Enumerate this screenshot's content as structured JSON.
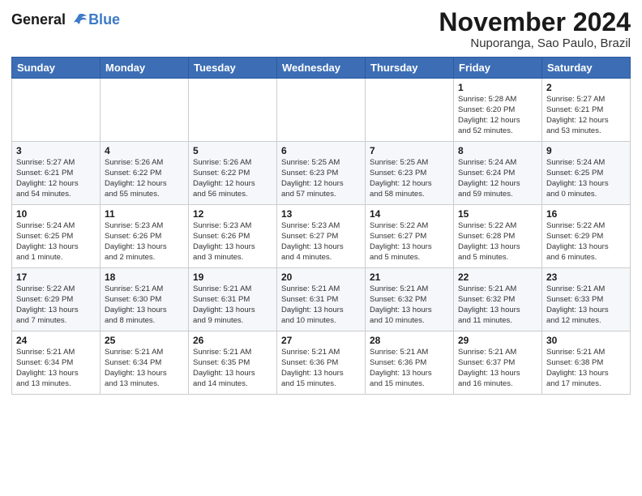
{
  "logo": {
    "line1": "General",
    "line2": "Blue"
  },
  "title": "November 2024",
  "location": "Nuporanga, Sao Paulo, Brazil",
  "weekdays": [
    "Sunday",
    "Monday",
    "Tuesday",
    "Wednesday",
    "Thursday",
    "Friday",
    "Saturday"
  ],
  "weeks": [
    [
      {
        "day": "",
        "info": ""
      },
      {
        "day": "",
        "info": ""
      },
      {
        "day": "",
        "info": ""
      },
      {
        "day": "",
        "info": ""
      },
      {
        "day": "",
        "info": ""
      },
      {
        "day": "1",
        "info": "Sunrise: 5:28 AM\nSunset: 6:20 PM\nDaylight: 12 hours\nand 52 minutes."
      },
      {
        "day": "2",
        "info": "Sunrise: 5:27 AM\nSunset: 6:21 PM\nDaylight: 12 hours\nand 53 minutes."
      }
    ],
    [
      {
        "day": "3",
        "info": "Sunrise: 5:27 AM\nSunset: 6:21 PM\nDaylight: 12 hours\nand 54 minutes."
      },
      {
        "day": "4",
        "info": "Sunrise: 5:26 AM\nSunset: 6:22 PM\nDaylight: 12 hours\nand 55 minutes."
      },
      {
        "day": "5",
        "info": "Sunrise: 5:26 AM\nSunset: 6:22 PM\nDaylight: 12 hours\nand 56 minutes."
      },
      {
        "day": "6",
        "info": "Sunrise: 5:25 AM\nSunset: 6:23 PM\nDaylight: 12 hours\nand 57 minutes."
      },
      {
        "day": "7",
        "info": "Sunrise: 5:25 AM\nSunset: 6:23 PM\nDaylight: 12 hours\nand 58 minutes."
      },
      {
        "day": "8",
        "info": "Sunrise: 5:24 AM\nSunset: 6:24 PM\nDaylight: 12 hours\nand 59 minutes."
      },
      {
        "day": "9",
        "info": "Sunrise: 5:24 AM\nSunset: 6:25 PM\nDaylight: 13 hours\nand 0 minutes."
      }
    ],
    [
      {
        "day": "10",
        "info": "Sunrise: 5:24 AM\nSunset: 6:25 PM\nDaylight: 13 hours\nand 1 minute."
      },
      {
        "day": "11",
        "info": "Sunrise: 5:23 AM\nSunset: 6:26 PM\nDaylight: 13 hours\nand 2 minutes."
      },
      {
        "day": "12",
        "info": "Sunrise: 5:23 AM\nSunset: 6:26 PM\nDaylight: 13 hours\nand 3 minutes."
      },
      {
        "day": "13",
        "info": "Sunrise: 5:23 AM\nSunset: 6:27 PM\nDaylight: 13 hours\nand 4 minutes."
      },
      {
        "day": "14",
        "info": "Sunrise: 5:22 AM\nSunset: 6:27 PM\nDaylight: 13 hours\nand 5 minutes."
      },
      {
        "day": "15",
        "info": "Sunrise: 5:22 AM\nSunset: 6:28 PM\nDaylight: 13 hours\nand 5 minutes."
      },
      {
        "day": "16",
        "info": "Sunrise: 5:22 AM\nSunset: 6:29 PM\nDaylight: 13 hours\nand 6 minutes."
      }
    ],
    [
      {
        "day": "17",
        "info": "Sunrise: 5:22 AM\nSunset: 6:29 PM\nDaylight: 13 hours\nand 7 minutes."
      },
      {
        "day": "18",
        "info": "Sunrise: 5:21 AM\nSunset: 6:30 PM\nDaylight: 13 hours\nand 8 minutes."
      },
      {
        "day": "19",
        "info": "Sunrise: 5:21 AM\nSunset: 6:31 PM\nDaylight: 13 hours\nand 9 minutes."
      },
      {
        "day": "20",
        "info": "Sunrise: 5:21 AM\nSunset: 6:31 PM\nDaylight: 13 hours\nand 10 minutes."
      },
      {
        "day": "21",
        "info": "Sunrise: 5:21 AM\nSunset: 6:32 PM\nDaylight: 13 hours\nand 10 minutes."
      },
      {
        "day": "22",
        "info": "Sunrise: 5:21 AM\nSunset: 6:32 PM\nDaylight: 13 hours\nand 11 minutes."
      },
      {
        "day": "23",
        "info": "Sunrise: 5:21 AM\nSunset: 6:33 PM\nDaylight: 13 hours\nand 12 minutes."
      }
    ],
    [
      {
        "day": "24",
        "info": "Sunrise: 5:21 AM\nSunset: 6:34 PM\nDaylight: 13 hours\nand 13 minutes."
      },
      {
        "day": "25",
        "info": "Sunrise: 5:21 AM\nSunset: 6:34 PM\nDaylight: 13 hours\nand 13 minutes."
      },
      {
        "day": "26",
        "info": "Sunrise: 5:21 AM\nSunset: 6:35 PM\nDaylight: 13 hours\nand 14 minutes."
      },
      {
        "day": "27",
        "info": "Sunrise: 5:21 AM\nSunset: 6:36 PM\nDaylight: 13 hours\nand 15 minutes."
      },
      {
        "day": "28",
        "info": "Sunrise: 5:21 AM\nSunset: 6:36 PM\nDaylight: 13 hours\nand 15 minutes."
      },
      {
        "day": "29",
        "info": "Sunrise: 5:21 AM\nSunset: 6:37 PM\nDaylight: 13 hours\nand 16 minutes."
      },
      {
        "day": "30",
        "info": "Sunrise: 5:21 AM\nSunset: 6:38 PM\nDaylight: 13 hours\nand 17 minutes."
      }
    ]
  ]
}
